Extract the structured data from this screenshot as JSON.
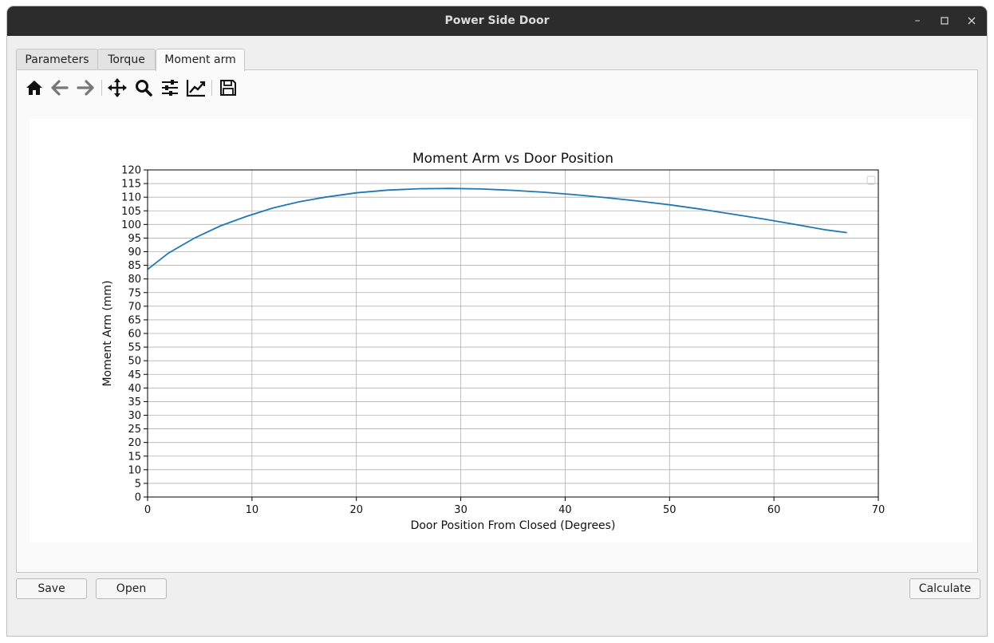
{
  "window": {
    "title": "Power Side Door",
    "controls": [
      "minimize",
      "maximize",
      "close"
    ]
  },
  "tabs": [
    {
      "label": "Parameters",
      "active": false
    },
    {
      "label": "Torque",
      "active": false
    },
    {
      "label": "Moment arm",
      "active": true
    }
  ],
  "toolbar": {
    "icons": [
      "home-icon",
      "back-icon",
      "forward-icon",
      "pan-icon",
      "zoom-icon",
      "configure-subplots-icon",
      "edit-axis-icon",
      "save-figure-icon"
    ]
  },
  "buttons": {
    "save": "Save",
    "open": "Open",
    "calculate": "Calculate"
  },
  "chart_data": {
    "type": "line",
    "title": "Moment Arm vs Door Position",
    "xlabel": "Door Position From Closed (Degrees)",
    "ylabel": "Moment Arm (mm)",
    "xlim": [
      0,
      70
    ],
    "ylim": [
      0,
      120
    ],
    "xticks": [
      0,
      10,
      20,
      30,
      40,
      50,
      60,
      70
    ],
    "yticks": [
      0,
      5,
      10,
      15,
      20,
      25,
      30,
      35,
      40,
      45,
      50,
      55,
      60,
      65,
      70,
      75,
      80,
      85,
      90,
      95,
      100,
      105,
      110,
      115,
      120
    ],
    "grid": true,
    "legend": "top-right",
    "color": "#1f77b4",
    "series": [
      {
        "x": [
          0,
          2,
          4.5,
          7,
          9.5,
          12,
          14.5,
          17,
          20,
          23,
          26,
          29,
          32,
          35,
          38,
          41,
          44,
          47,
          50,
          53,
          56,
          59,
          62,
          65,
          67
        ],
        "y": [
          83.5,
          89.5,
          95,
          99.5,
          103,
          106,
          108.3,
          110,
          111.6,
          112.6,
          113.1,
          113.2,
          113,
          112.5,
          111.8,
          110.9,
          109.8,
          108.6,
          107.2,
          105.6,
          103.8,
          102,
          100,
          98,
          97
        ]
      }
    ]
  }
}
